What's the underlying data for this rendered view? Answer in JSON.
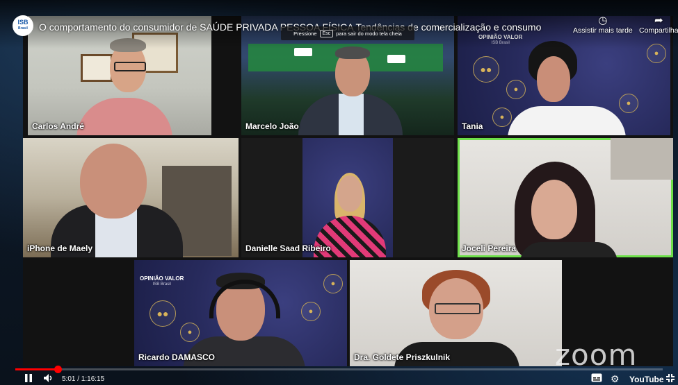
{
  "channel": {
    "logo_text": "ISB",
    "logo_sub": "Brasil"
  },
  "video": {
    "title": "O comportamento do consumidor de SAÚDE PRIVADA PESSOA FÍSICA Tendências de comercialização e consumo"
  },
  "fullscreen_hint": {
    "prefix": "Pressione",
    "key": "Esc",
    "suffix": "para sair do modo tela cheia"
  },
  "top_actions": [
    {
      "label": "Assistir mais tarde",
      "icon": "clock-icon"
    },
    {
      "label": "Compartilhar",
      "icon": "share-icon"
    }
  ],
  "brand_card": {
    "line1": "OPINIÃO",
    "mid": "de",
    "line2": "VALOR",
    "sub": "ISB Brasil"
  },
  "participants": [
    {
      "name": "Carlos André"
    },
    {
      "name": "Marcelo João"
    },
    {
      "name": "Tania"
    },
    {
      "name": "iPhone de Maely"
    },
    {
      "name": "Danielle Saad Ribeiro"
    },
    {
      "name": "Joceli Pereira",
      "active": true
    },
    {
      "name": "Ricardo DAMASCO"
    },
    {
      "name": "Dra. Goldete Priszkulnik"
    }
  ],
  "watermark": "zoom",
  "player": {
    "current_time": "5:01",
    "duration": "1:16:15",
    "time_display": "5:01 / 1:16:15",
    "progress_fraction": 0.0657,
    "brand": "YouTube",
    "accent_color": "#ff0000",
    "speaker_highlight_color": "#6ee04a"
  }
}
